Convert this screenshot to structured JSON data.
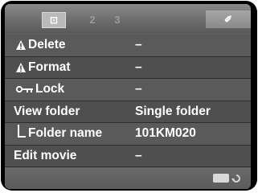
{
  "tabs": [
    {
      "name": "playback",
      "glyph": "⊡"
    },
    {
      "name": "tab-2",
      "glyph": "2"
    },
    {
      "name": "tab-3",
      "glyph": "3"
    },
    {
      "name": "setup",
      "glyph": "✐"
    }
  ],
  "menu": [
    {
      "label": "Delete",
      "value": "–",
      "icon": "warning-icon"
    },
    {
      "label": "Format",
      "value": "–",
      "icon": "warning-icon"
    },
    {
      "label": "Lock",
      "value": "–",
      "icon": "key-icon"
    },
    {
      "label": "View folder",
      "value": "Single folder"
    },
    {
      "label": "Folder name",
      "value": "101KM020",
      "icon": "sub-item-elbow-icon"
    },
    {
      "label": "Edit movie",
      "value": "–"
    }
  ],
  "colors": {
    "background": "#5e5e5e",
    "text": "#ffffff",
    "bezel": "#000000"
  }
}
